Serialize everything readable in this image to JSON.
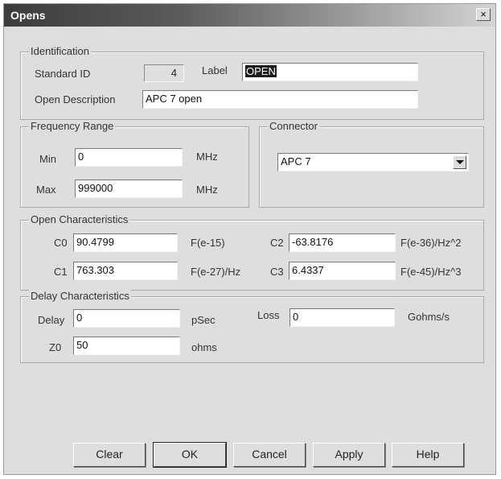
{
  "window": {
    "title": "Opens",
    "close_glyph": "×"
  },
  "identification": {
    "legend": "Identification",
    "standard_id_label": "Standard ID",
    "standard_id_value": "4",
    "label_label": "Label",
    "label_value": "OPEN",
    "description_label": "Open Description",
    "description_value": "APC 7  open"
  },
  "frequency": {
    "legend": "Frequency Range",
    "min_label": "Min",
    "min_value": "0",
    "min_unit": "MHz",
    "max_label": "Max",
    "max_value": "999000",
    "max_unit": "MHz"
  },
  "connector": {
    "legend": "Connector",
    "selected": "APC 7",
    "icon": "chevron-down-icon"
  },
  "open_characteristics": {
    "legend": "Open Characteristics",
    "c0_label": "C0",
    "c0_value": "90.4799",
    "c0_unit": "F(e-15)",
    "c1_label": "C1",
    "c1_value": "763.303",
    "c1_unit": "F(e-27)/Hz",
    "c2_label": "C2",
    "c2_value": "-63.8176",
    "c2_unit": "F(e-36)/Hz^2",
    "c3_label": "C3",
    "c3_value": "6.4337",
    "c3_unit": "F(e-45)/Hz^3"
  },
  "delay_characteristics": {
    "legend": "Delay Characteristics",
    "delay_label": "Delay",
    "delay_value": "0",
    "delay_unit": "pSec",
    "loss_label": "Loss",
    "loss_value": "0",
    "loss_unit": "Gohms/s",
    "z0_label": "Z0",
    "z0_value": "50",
    "z0_unit": "ohms"
  },
  "buttons": {
    "clear": "Clear",
    "ok": "OK",
    "cancel": "Cancel",
    "apply": "Apply",
    "help": "Help"
  }
}
